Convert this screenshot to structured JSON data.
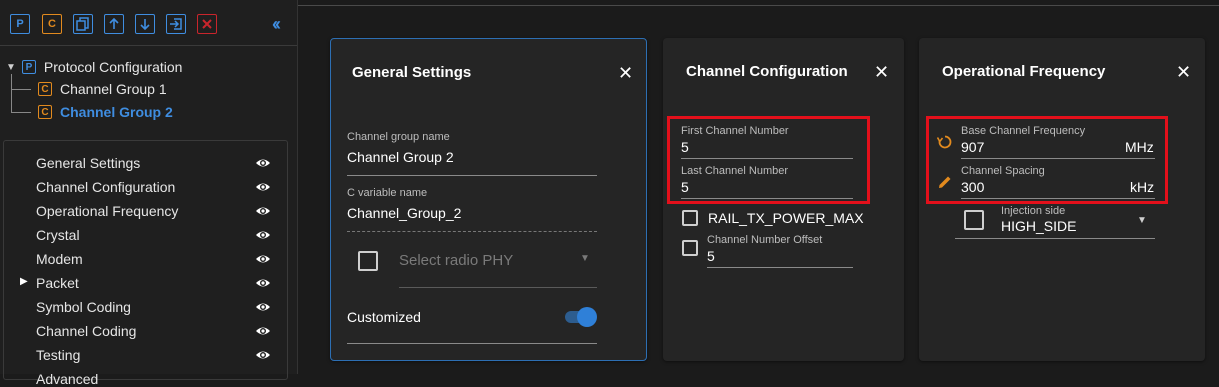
{
  "toolbar": {
    "icons": [
      "protocol-icon",
      "channel-group-icon",
      "copy-icon",
      "move-up-icon",
      "move-down-icon",
      "import-icon",
      "delete-icon",
      "collapse-icon"
    ],
    "p_glyph": "P",
    "c_glyph": "C"
  },
  "tree": {
    "root_label": "Protocol Configuration",
    "root_badge": "P",
    "child_badge": "C",
    "items": [
      "Channel Group 1",
      "Channel Group 2"
    ]
  },
  "sections": [
    "General Settings",
    "Channel Configuration",
    "Operational Frequency",
    "Crystal",
    "Modem",
    "Packet",
    "Symbol Coding",
    "Channel Coding",
    "Testing",
    "Advanced"
  ],
  "general": {
    "title": "General Settings",
    "group_name_label": "Channel group name",
    "group_name_value": "Channel Group 2",
    "cvar_label": "C variable name",
    "cvar_value": "Channel_Group_2",
    "phy_placeholder": "Select radio PHY",
    "customized_label": "Customized",
    "customized_on": true
  },
  "channel": {
    "title": "Channel Configuration",
    "first_label": "First Channel Number",
    "first_value": "5",
    "last_label": "Last Channel Number",
    "last_value": "5",
    "tx_power_label": "RAIL_TX_POWER_MAX",
    "offset_label": "Channel Number Offset",
    "offset_value": "5"
  },
  "frequency": {
    "title": "Operational Frequency",
    "base_label": "Base Channel Frequency",
    "base_value": "907",
    "base_unit": "MHz",
    "spacing_label": "Channel Spacing",
    "spacing_value": "300",
    "spacing_unit": "kHz",
    "injection_label": "Injection side",
    "injection_value": "HIGH_SIDE"
  },
  "colors": {
    "accent": "#3f8de0",
    "orange": "#e28a1e",
    "highlight": "#e3101b",
    "active_item": "#3f8de0"
  }
}
